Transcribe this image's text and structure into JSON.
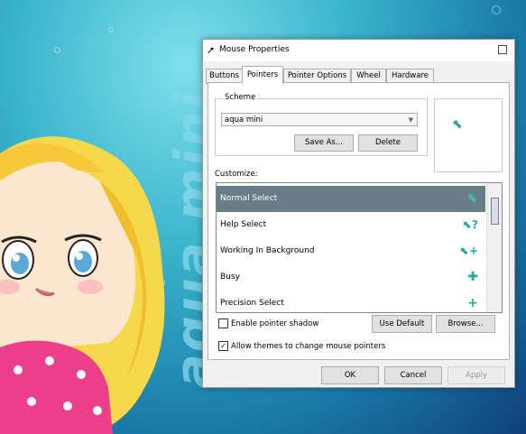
{
  "wallpaper": {
    "text": "aqua mini"
  },
  "dialog": {
    "title": "Mouse Properties",
    "tabs": [
      {
        "label": "Buttons"
      },
      {
        "label": "Pointers"
      },
      {
        "label": "Pointer Options"
      },
      {
        "label": "Wheel"
      },
      {
        "label": "Hardware"
      }
    ],
    "active_tab": "Pointers",
    "scheme": {
      "legend": "Scheme",
      "selected": "aqua mini",
      "save_as_label": "Save As...",
      "delete_label": "Delete"
    },
    "customize": {
      "label": "Customize:",
      "items": [
        {
          "label": "Normal Select",
          "icon": "arrow-cursor-icon",
          "selected": true
        },
        {
          "label": "Help Select",
          "icon": "help-cursor-icon"
        },
        {
          "label": "Working In Background",
          "icon": "working-cursor-icon"
        },
        {
          "label": "Busy",
          "icon": "busy-cursor-icon"
        },
        {
          "label": "Precision Select",
          "icon": "crosshair-cursor-icon"
        }
      ]
    },
    "enable_shadow_label": "Enable pointer shadow",
    "enable_shadow_checked": false,
    "allow_themes_label": "Allow themes to change mouse pointers",
    "allow_themes_checked": true,
    "use_default_label": "Use Default",
    "browse_label": "Browse...",
    "ok_label": "OK",
    "cancel_label": "Cancel",
    "apply_label": "Apply",
    "accent_color": "#26a899",
    "selection_color": "#697d88"
  }
}
